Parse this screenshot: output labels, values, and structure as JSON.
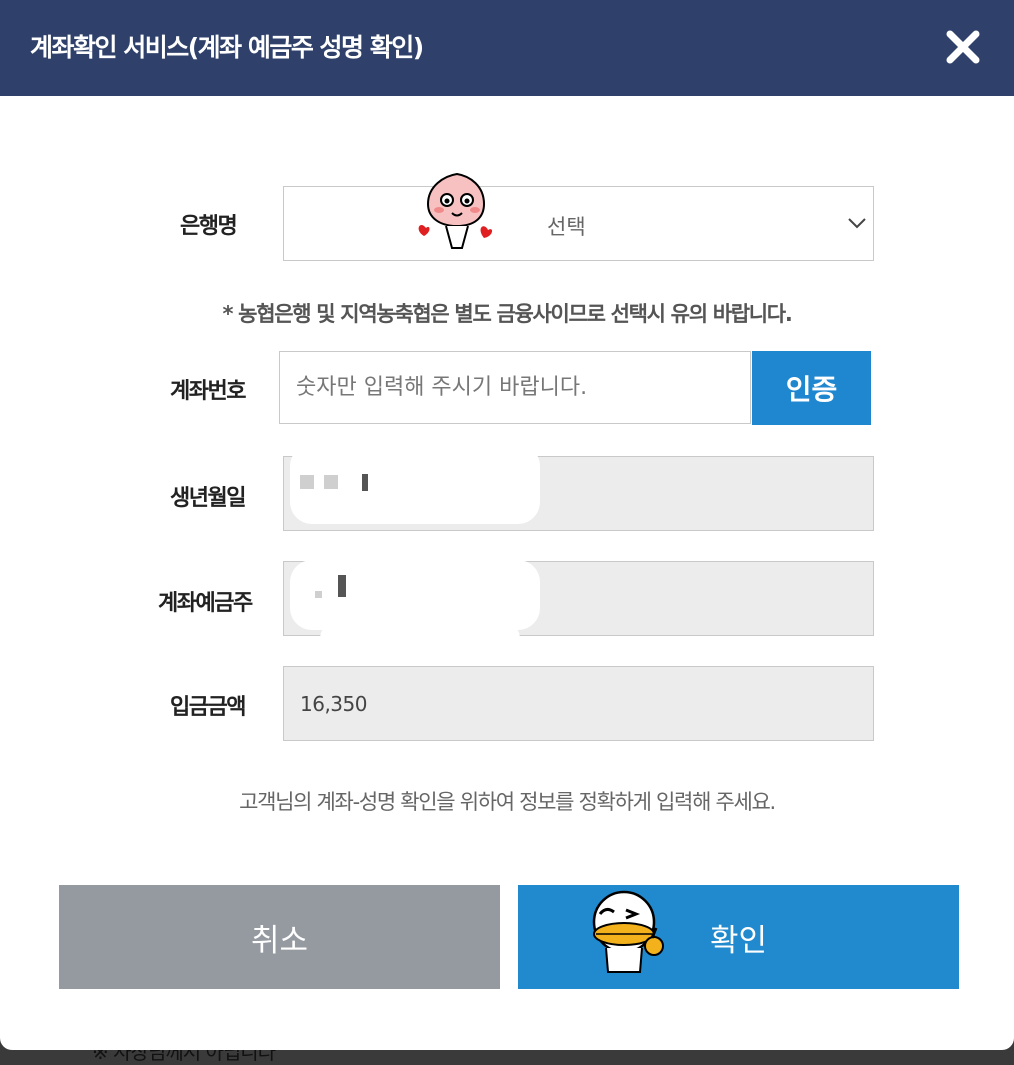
{
  "header": {
    "title": "계좌확인 서비스(계좌 예금주 성명 확인)",
    "close_icon": "close-x-icon"
  },
  "bank": {
    "label": "은행명",
    "selected": "선택",
    "note": "* 농협은행 및 지역농축협은 별도 금융사이므로 선택시 유의 바랍니다."
  },
  "account": {
    "label": "계좌번호",
    "placeholder": "숫자만 입력해 주시기 바랍니다.",
    "verify_button": "인증"
  },
  "birth": {
    "label": "생년월일"
  },
  "holder": {
    "label": "계좌예금주"
  },
  "amount": {
    "label": "입금금액",
    "value": "16,350"
  },
  "guide_text": "고객님의 계좌-성명 확인을 위하여 정보를 정확하게 입력해 주세요.",
  "buttons": {
    "cancel": "취소",
    "confirm": "확인"
  },
  "behind_text": "※ 사장님께서 아닙니다",
  "colors": {
    "header_bg": "#2f416a",
    "primary": "#1f87cf",
    "cancel_bg": "#959aa1",
    "readonly_bg": "#ececec"
  }
}
